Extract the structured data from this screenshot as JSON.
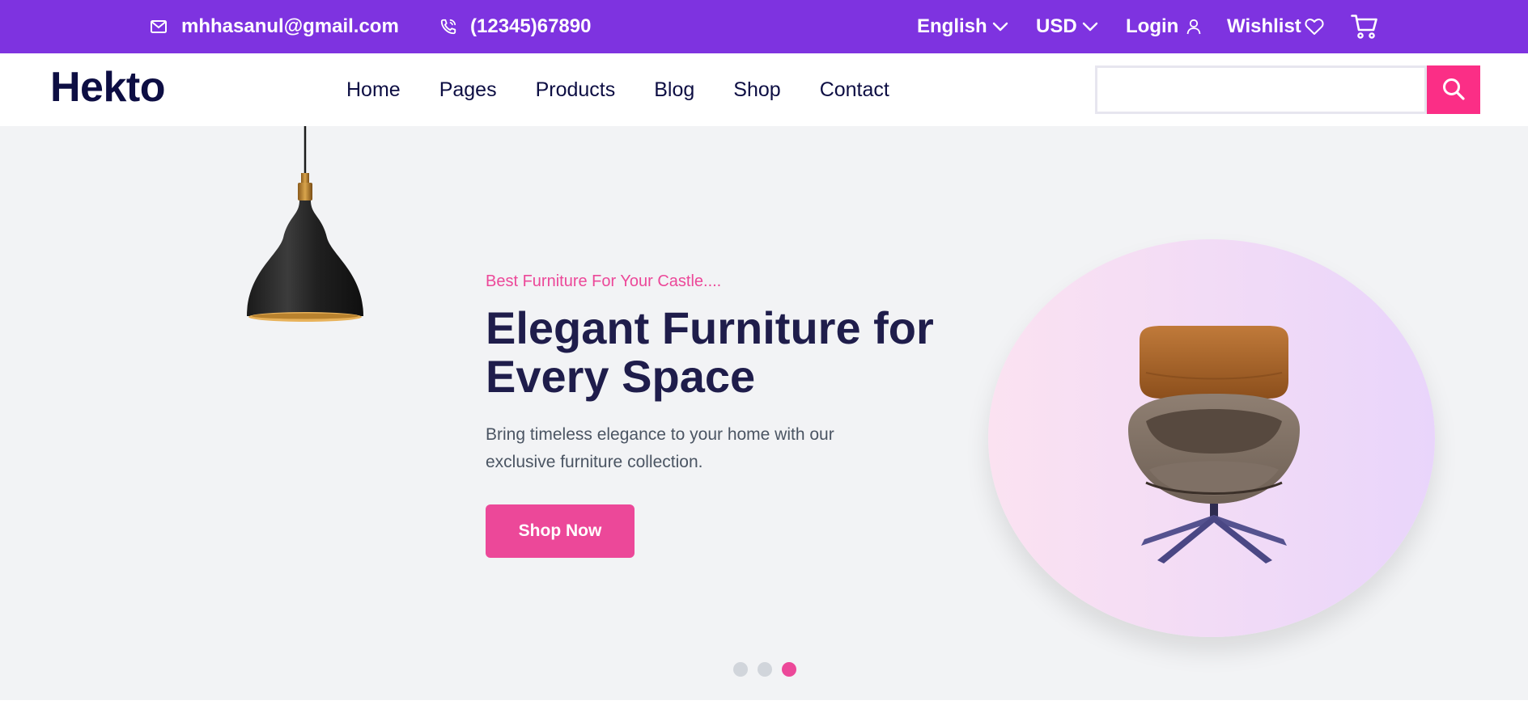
{
  "colors": {
    "topbar_bg": "#7e33e0",
    "accent_pink": "#fb2e86",
    "button_pink": "#ec4899",
    "logo_navy": "#0d0e43",
    "hero_bg": "#f2f3f5"
  },
  "topbar": {
    "email": "mhhasanul@gmail.com",
    "email_icon": "mail-icon",
    "phone": "(12345)67890",
    "phone_icon": "phone-icon",
    "language": "English",
    "currency": "USD",
    "login": "Login",
    "login_icon": "user-icon",
    "wishlist": "Wishlist",
    "wishlist_icon": "heart-icon",
    "cart_icon": "cart-icon"
  },
  "navbar": {
    "logo": "Hekto",
    "links": [
      "Home",
      "Pages",
      "Products",
      "Blog",
      "Shop",
      "Contact"
    ],
    "search": {
      "placeholder": "",
      "value": "",
      "icon": "search-icon"
    }
  },
  "hero": {
    "tagline": "Best Furniture For Your Castle....",
    "headline": "Elegant Furniture for Every Space",
    "subtext": "Bring timeless elegance to your home with our exclusive furniture collection.",
    "cta": "Shop Now",
    "lamp_image": "pendant-lamp-image",
    "product_image": "armchair-image",
    "slides": {
      "count": 3,
      "active_index": 2
    }
  }
}
